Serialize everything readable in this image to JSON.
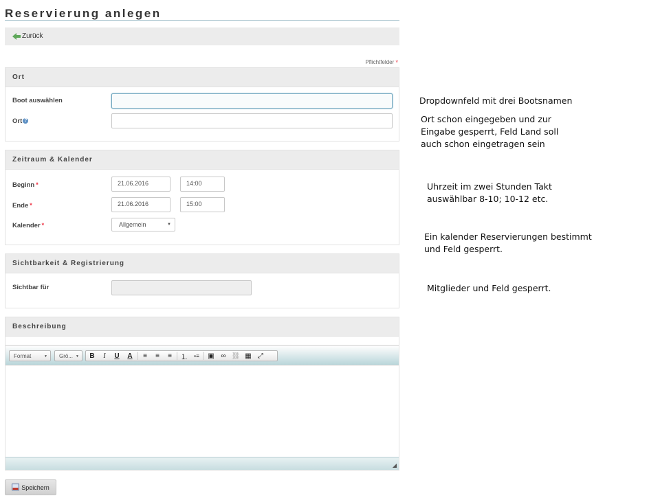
{
  "page": {
    "title": "Reservierung anlegen"
  },
  "toolbar": {
    "back_label": "Zurück",
    "back_icon": "arrow-left-icon"
  },
  "required_note": {
    "label": "Pflichtfelder",
    "marker": "*"
  },
  "sections": {
    "ort": {
      "heading": "Ort",
      "boat_label": "Boot auswählen",
      "boat_value": "",
      "location_label": "Ort",
      "location_help": "?",
      "location_value": ""
    },
    "zeitraum": {
      "heading": "Zeitraum & Kalender",
      "begin_label": "Beginn",
      "begin_date": "21.06.2016",
      "begin_time": "14:00",
      "end_label": "Ende",
      "end_date": "21.06.2016",
      "end_time": "15:00",
      "calendar_label": "Kalender",
      "calendar_value": "Allgemein",
      "required_marker": "*"
    },
    "sichtbarkeit": {
      "heading": "Sichtbarkeit & Registrierung",
      "visible_label": "Sichtbar für",
      "visible_value": ""
    },
    "beschreibung": {
      "heading": "Beschreibung",
      "format_label": "Format",
      "size_label": "Grö...",
      "buttons": {
        "bold": "B",
        "italic": "I",
        "underline": "U",
        "text_color": "A",
        "align_left": "≡",
        "align_center": "≡",
        "align_right": "≡",
        "ordered_list": "⒈",
        "bullet_list": "•≡",
        "image": "▣",
        "link": "∞",
        "unlink": "⛓",
        "table": "▦",
        "fullscreen": "⤢"
      },
      "resize": "◢"
    }
  },
  "save_button": {
    "label": "Speichern"
  },
  "notes": {
    "n1": "Dropdownfeld mit drei Bootsnamen",
    "n2a": "Ort schon eingegeben und zur",
    "n2b": "Eingabe gesperrt, Feld Land soll",
    "n2c": "auch schon eingetragen sein",
    "n3a": "Uhrzeit im zwei Stunden Takt",
    "n3b": "auswählbar 8-10; 10-12 etc.",
    "n4a": "Ein kalender Reservierungen bestimmt",
    "n4b": "und Feld gesperrt.",
    "n5": "Mitglieder und Feld gesperrt."
  },
  "colors": {
    "required": "#ee3344",
    "accent_border": "#6aa3bd",
    "section_bg": "#ececec"
  }
}
